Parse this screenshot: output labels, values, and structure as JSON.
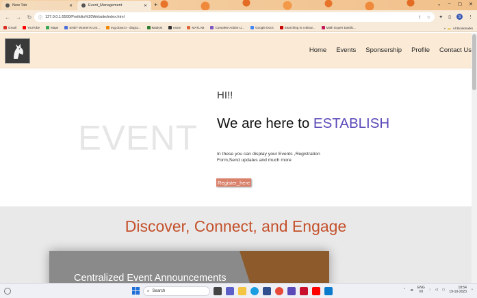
{
  "browser": {
    "tabs": [
      {
        "title": "New Tab",
        "active": false
      },
      {
        "title": "Event_Management",
        "active": true
      }
    ],
    "url": "127.0.0.1:5500/Portfolio%20Website/index.html",
    "profile_initial": "S",
    "bookmarks": [
      {
        "label": "Gmail",
        "color": "#d93025"
      },
      {
        "label": "YouTube",
        "color": "#ff0000"
      },
      {
        "label": "Maps",
        "color": "#34a853"
      },
      {
        "label": "SNDT Women's Uni...",
        "color": "#4a6fd8"
      },
      {
        "label": "svg.draw.io - diagra...",
        "color": "#f08705"
      },
      {
        "label": "katalyst",
        "color": "#2e7d32"
      },
      {
        "label": "exam",
        "color": "#333333"
      },
      {
        "label": "MATLAB",
        "color": "#e16737"
      },
      {
        "label": "Complete Adobe Li...",
        "color": "#7e57c2"
      },
      {
        "label": "Google Docs",
        "color": "#4285f4"
      },
      {
        "label": "Searching in a Binar...",
        "color": "#cc0000"
      },
      {
        "label": "Math Expert Dashb...",
        "color": "#c2185b"
      }
    ],
    "all_bookmarks_label": "All Bookmarks"
  },
  "site": {
    "nav": [
      "Home",
      "Events",
      "Sponsership",
      "Profile",
      "Contact Us"
    ],
    "hero": {
      "watermark": "EVENT",
      "greeting": "HI!!",
      "headline_prefix": "We are here to ",
      "headline_accent": "ESTABLISH",
      "description": "In these you can display your Events ,Registration Form,Send updates and much more",
      "register_label": "Register_here"
    },
    "discover": {
      "title": "Discover, Connect, and Engage",
      "card_title": "Centralized Event Announcements"
    }
  },
  "taskbar": {
    "search_label": "Search",
    "lang_top": "ENG",
    "lang_bottom": "IN",
    "time": "18:54",
    "date": "19-10-2023"
  },
  "colors": {
    "header_bg": "#fbebd6",
    "accent_blue": "#5a4ab8",
    "title_orange": "#c4512b",
    "button_bg": "#d9816a"
  }
}
